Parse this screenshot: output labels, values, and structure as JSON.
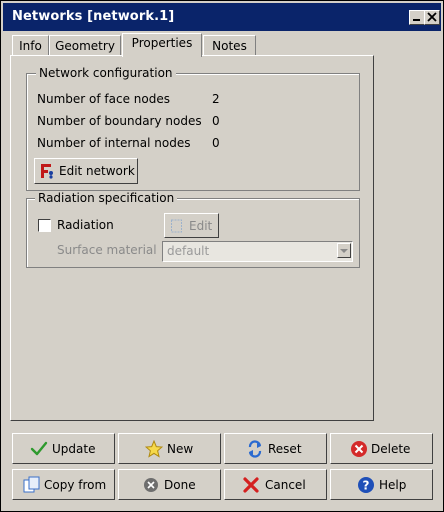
{
  "window": {
    "title": "Networks [network.1]"
  },
  "tabs": [
    {
      "label": "Info"
    },
    {
      "label": "Geometry"
    },
    {
      "label": "Properties"
    },
    {
      "label": "Notes"
    }
  ],
  "network_config": {
    "legend": "Network configuration",
    "rows": [
      {
        "label": "Number of face nodes",
        "value": "2"
      },
      {
        "label": "Number of boundary nodes",
        "value": "0"
      },
      {
        "label": "Number of internal nodes",
        "value": "0"
      }
    ],
    "edit_button": "Edit network"
  },
  "radiation": {
    "legend": "Radiation specification",
    "checkbox_label": "Radiation",
    "checked": false,
    "edit_button": "Edit",
    "surface_label": "Surface material",
    "surface_value": "default"
  },
  "actions": {
    "update": "Update",
    "new": "New",
    "reset": "Reset",
    "delete": "Delete",
    "copy_from": "Copy from",
    "done": "Done",
    "cancel": "Cancel",
    "help": "Help"
  },
  "colors": {
    "titlebar": "#0a246a",
    "face": "#d4d0c8"
  }
}
